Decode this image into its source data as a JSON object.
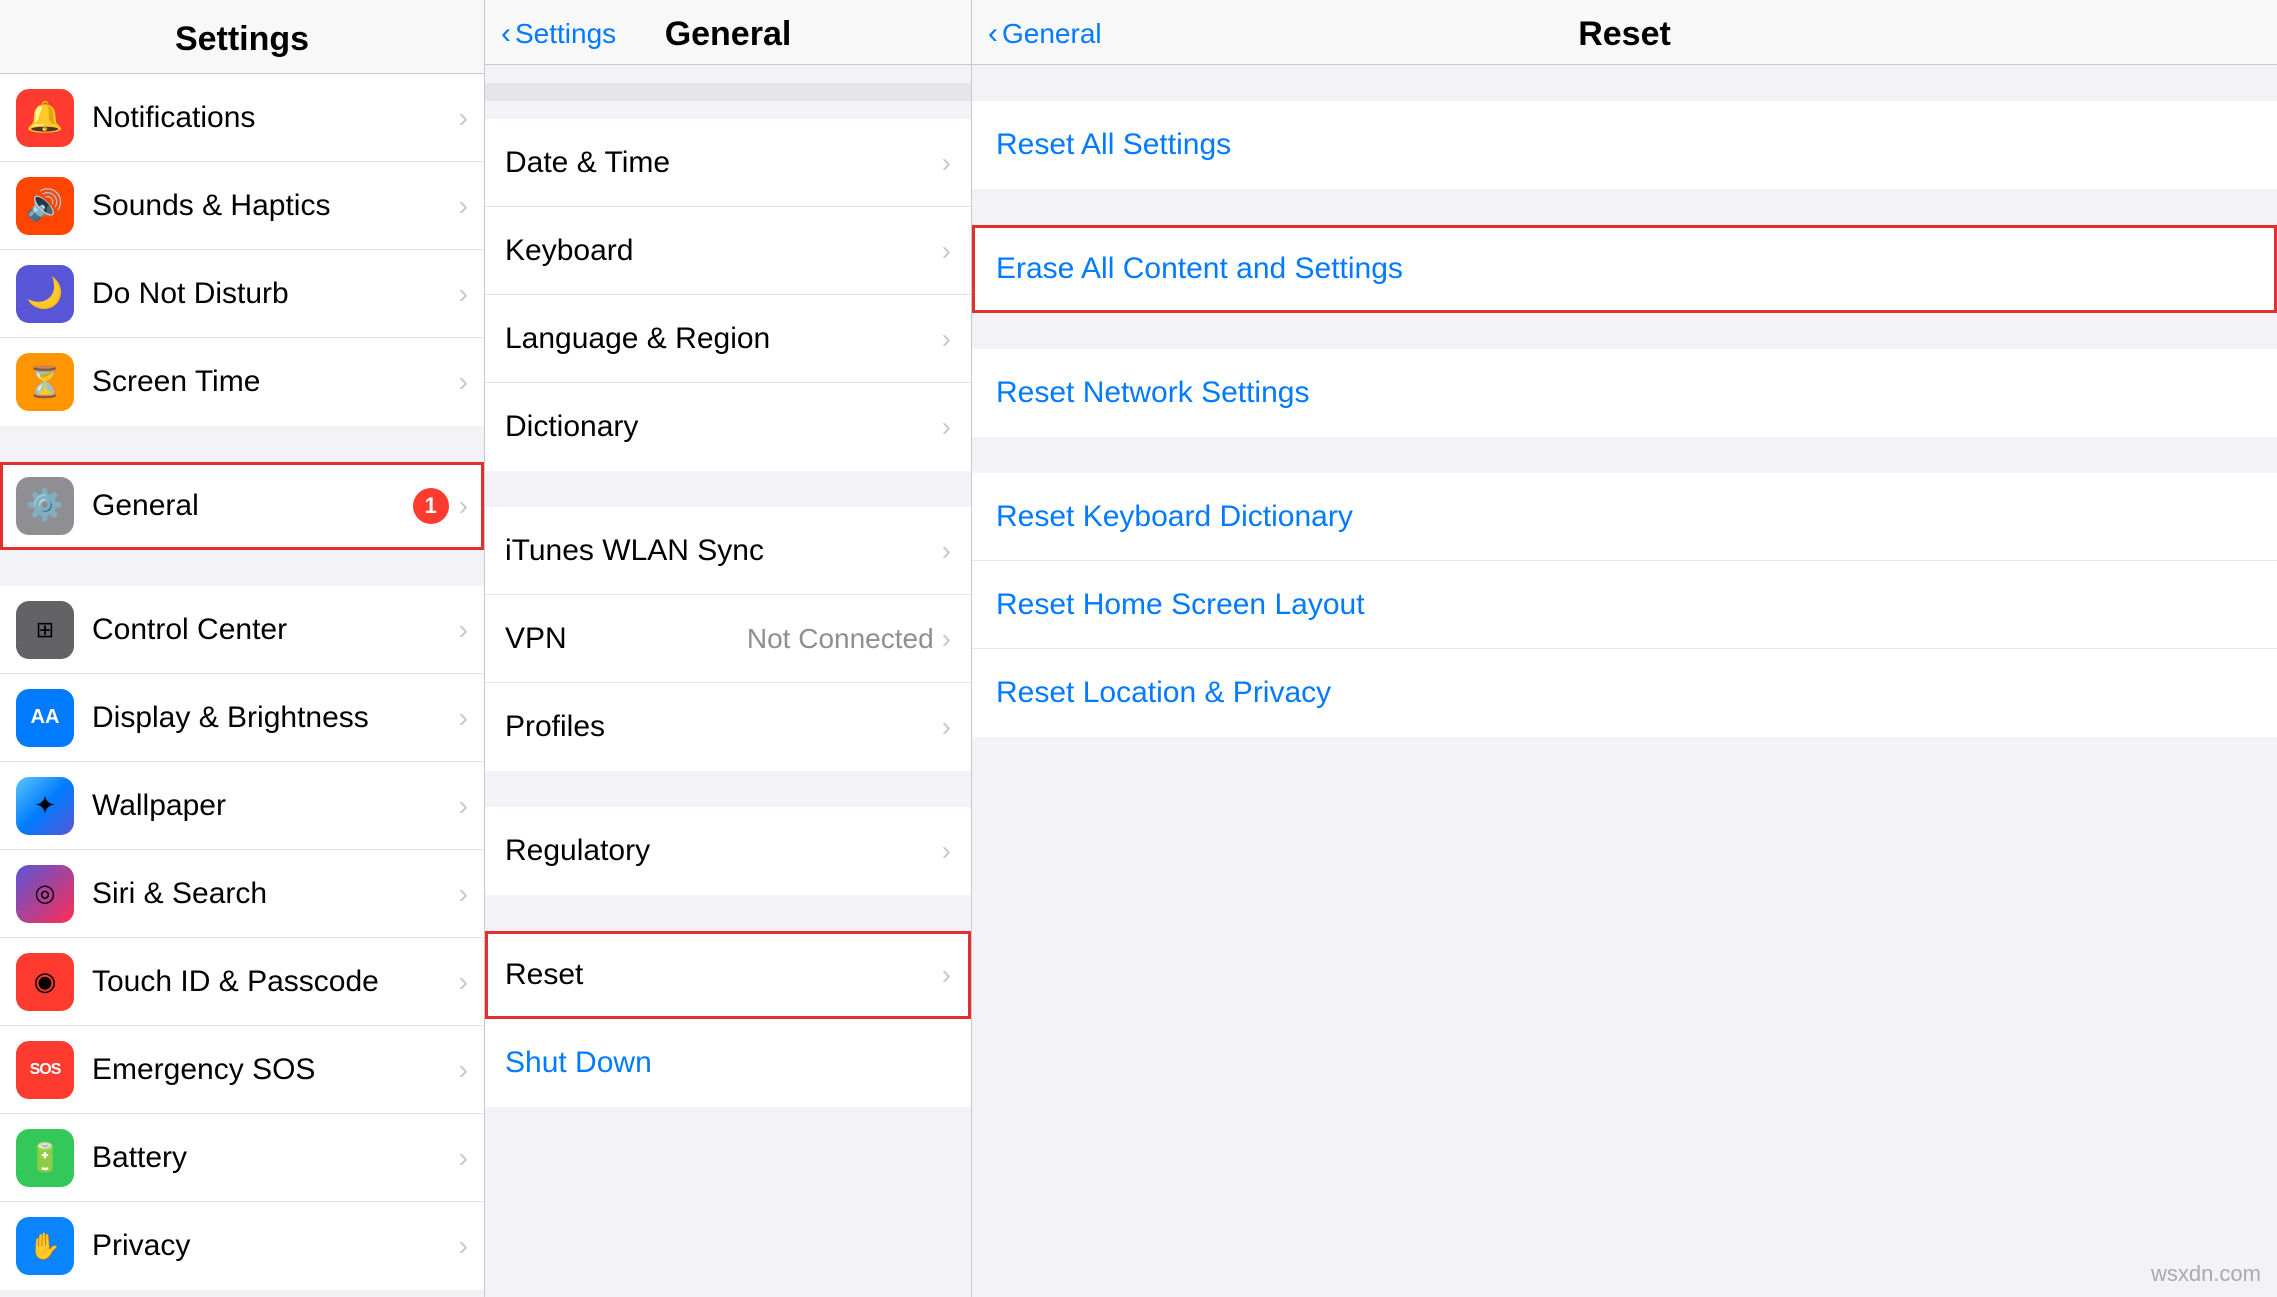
{
  "left_column": {
    "title": "Settings",
    "items": [
      {
        "id": "notifications",
        "label": "Notifications",
        "icon": "🔔",
        "bg": "bg-red",
        "badge": null,
        "selected": false
      },
      {
        "id": "sounds",
        "label": "Sounds & Haptics",
        "icon": "🔊",
        "bg": "bg-orange-red",
        "badge": null,
        "selected": false
      },
      {
        "id": "donotdisturb",
        "label": "Do Not Disturb",
        "icon": "🌙",
        "bg": "bg-purple",
        "badge": null,
        "selected": false
      },
      {
        "id": "screentime",
        "label": "Screen Time",
        "icon": "⏳",
        "bg": "bg-orange",
        "badge": null,
        "selected": false
      },
      {
        "id": "general",
        "label": "General",
        "icon": "⚙️",
        "bg": "bg-gray",
        "badge": "1",
        "selected": true
      },
      {
        "id": "controlcenter",
        "label": "Control Center",
        "icon": "⊞",
        "bg": "bg-dark-gray",
        "badge": null,
        "selected": false
      },
      {
        "id": "displaybrightness",
        "label": "Display & Brightness",
        "icon": "AA",
        "bg": "bg-blue",
        "badge": null,
        "selected": false
      },
      {
        "id": "wallpaper",
        "label": "Wallpaper",
        "icon": "✦",
        "bg": "bg-teal",
        "badge": null,
        "selected": false
      },
      {
        "id": "sirisearch",
        "label": "Siri & Search",
        "icon": "◎",
        "bg": "bg-pink-red",
        "badge": null,
        "selected": false
      },
      {
        "id": "touchid",
        "label": "Touch ID & Passcode",
        "icon": "◉",
        "bg": "bg-red",
        "badge": null,
        "selected": false
      },
      {
        "id": "emergencysos",
        "label": "Emergency SOS",
        "icon": "SOS",
        "bg": "bg-red-sos",
        "badge": null,
        "selected": false
      },
      {
        "id": "battery",
        "label": "Battery",
        "icon": "🔋",
        "bg": "bg-green",
        "badge": null,
        "selected": false
      },
      {
        "id": "privacy",
        "label": "Privacy",
        "icon": "✋",
        "bg": "bg-blue-dark",
        "badge": null,
        "selected": false
      }
    ]
  },
  "middle_column": {
    "back_label": "Settings",
    "title": "General",
    "sections": [
      {
        "items": [
          {
            "id": "datetime",
            "label": "Date & Time",
            "value": null,
            "selected": false
          },
          {
            "id": "keyboard",
            "label": "Keyboard",
            "value": null,
            "selected": false
          },
          {
            "id": "language",
            "label": "Language & Region",
            "value": null,
            "selected": false
          },
          {
            "id": "dictionary",
            "label": "Dictionary",
            "value": null,
            "selected": false
          }
        ]
      },
      {
        "items": [
          {
            "id": "icloudwlan",
            "label": "iTunes WLAN Sync",
            "value": null,
            "selected": false
          },
          {
            "id": "vpn",
            "label": "VPN",
            "value": "Not Connected",
            "selected": false
          },
          {
            "id": "profiles",
            "label": "Profiles",
            "value": null,
            "selected": false
          }
        ]
      },
      {
        "items": [
          {
            "id": "regulatory",
            "label": "Regulatory",
            "value": null,
            "selected": false
          }
        ]
      },
      {
        "items": [
          {
            "id": "reset",
            "label": "Reset",
            "value": null,
            "selected": true
          }
        ]
      }
    ],
    "shutdown_label": "Shut Down"
  },
  "right_column": {
    "back_label": "General",
    "title": "Reset",
    "sections": [
      {
        "items": [
          {
            "id": "reset-all-settings",
            "label": "Reset All Settings",
            "danger": false,
            "outlined": false
          }
        ]
      },
      {
        "items": [
          {
            "id": "erase-all",
            "label": "Erase All Content and Settings",
            "danger": false,
            "outlined": true
          }
        ]
      },
      {
        "items": [
          {
            "id": "reset-network",
            "label": "Reset Network Settings",
            "danger": false,
            "outlined": false
          }
        ]
      },
      {
        "items": [
          {
            "id": "reset-keyboard",
            "label": "Reset Keyboard Dictionary",
            "danger": false,
            "outlined": false
          },
          {
            "id": "reset-homescreen",
            "label": "Reset Home Screen Layout",
            "danger": false,
            "outlined": false
          },
          {
            "id": "reset-location",
            "label": "Reset Location & Privacy",
            "danger": false,
            "outlined": false
          }
        ]
      }
    ]
  },
  "watermark": "wsxdn.com"
}
